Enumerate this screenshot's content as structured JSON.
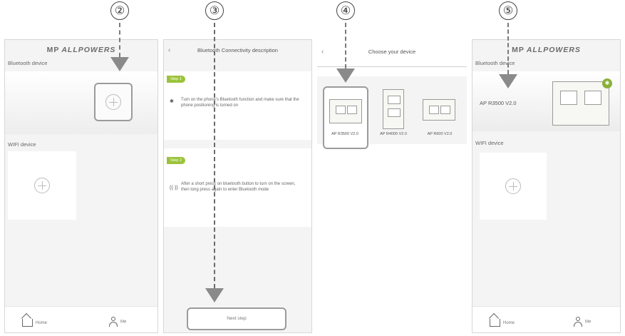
{
  "steps": [
    "②",
    "③",
    "④",
    "⑤"
  ],
  "brand": {
    "mark": "MP",
    "name": "ALLPOWERS"
  },
  "home": {
    "bluetooth_label": "Bluetooth device",
    "wifi_label": "WIFI device",
    "tab_home": "Home",
    "tab_me": "Me"
  },
  "connectivity": {
    "title": "Bluetooth Connectivity description",
    "step1_badge": "Step 1",
    "step1_text": "Turn on the phone's Bluetooth function and make sure that the phone positioning is turned on",
    "step2_badge": "Step 2",
    "step2_text": "After a short press on bluetooth button to turn on the screen, then long press again to enter Bluetooth mode",
    "next_button": "Next step"
  },
  "choose": {
    "title": "Choose your device",
    "devices": [
      "AP R3500 V2.0",
      "AP R4000 V2.0",
      "AP R600 V2.0"
    ]
  },
  "connected": {
    "device_name": "AP R3500 V2.0"
  },
  "colors": {
    "accent": "#9bc33a",
    "annotation": "#8a8a8a"
  }
}
